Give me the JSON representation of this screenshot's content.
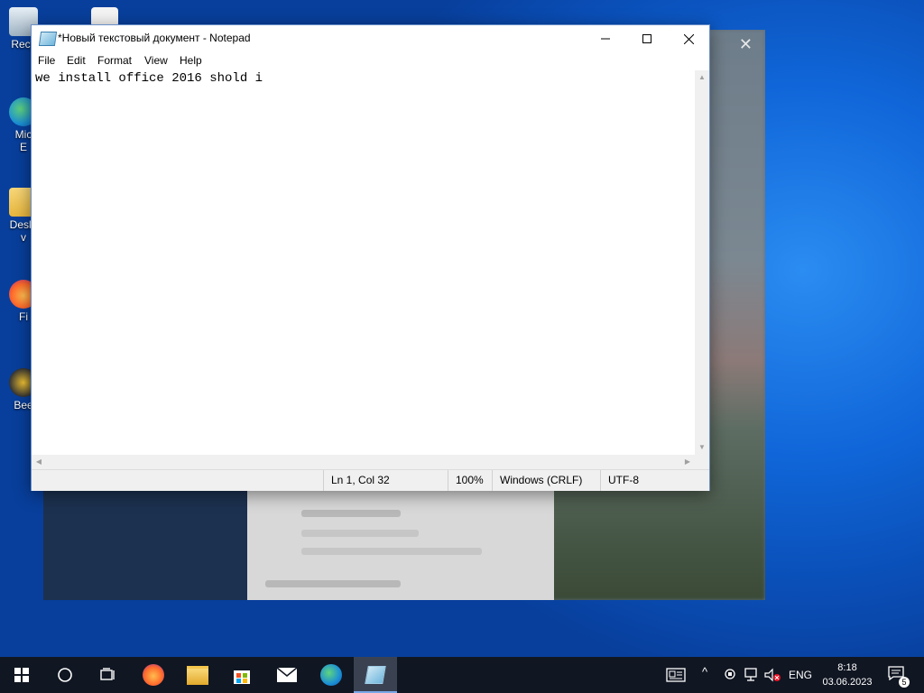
{
  "desktop": {
    "icons": [
      {
        "label": "Recy"
      },
      {
        "label": "Mic"
      },
      {
        "label": "E"
      },
      {
        "label": "Deskt"
      },
      {
        "label": "v"
      },
      {
        "label": "Fi"
      },
      {
        "label": "Bee"
      }
    ]
  },
  "notepad": {
    "title": "*Новый текстовый документ - Notepad",
    "menu": [
      "File",
      "Edit",
      "Format",
      "View",
      "Help"
    ],
    "content": "we install office 2016 shold i",
    "status": {
      "position": "Ln 1, Col 32",
      "zoom": "100%",
      "line_ending": "Windows (CRLF)",
      "encoding": "UTF-8"
    }
  },
  "taskbar": {
    "apps": [
      "start",
      "search",
      "task-view",
      "firefox",
      "file-explorer",
      "microsoft-store",
      "mail",
      "edge",
      "notepad"
    ],
    "tray": {
      "language": "ENG",
      "time": "8:18",
      "date": "03.06.2023",
      "notification_count": "5"
    }
  },
  "colors": {
    "desktop_accent": "#1066d8",
    "taskbar_bg": "#101622",
    "window_border": "#6a8fc8"
  }
}
